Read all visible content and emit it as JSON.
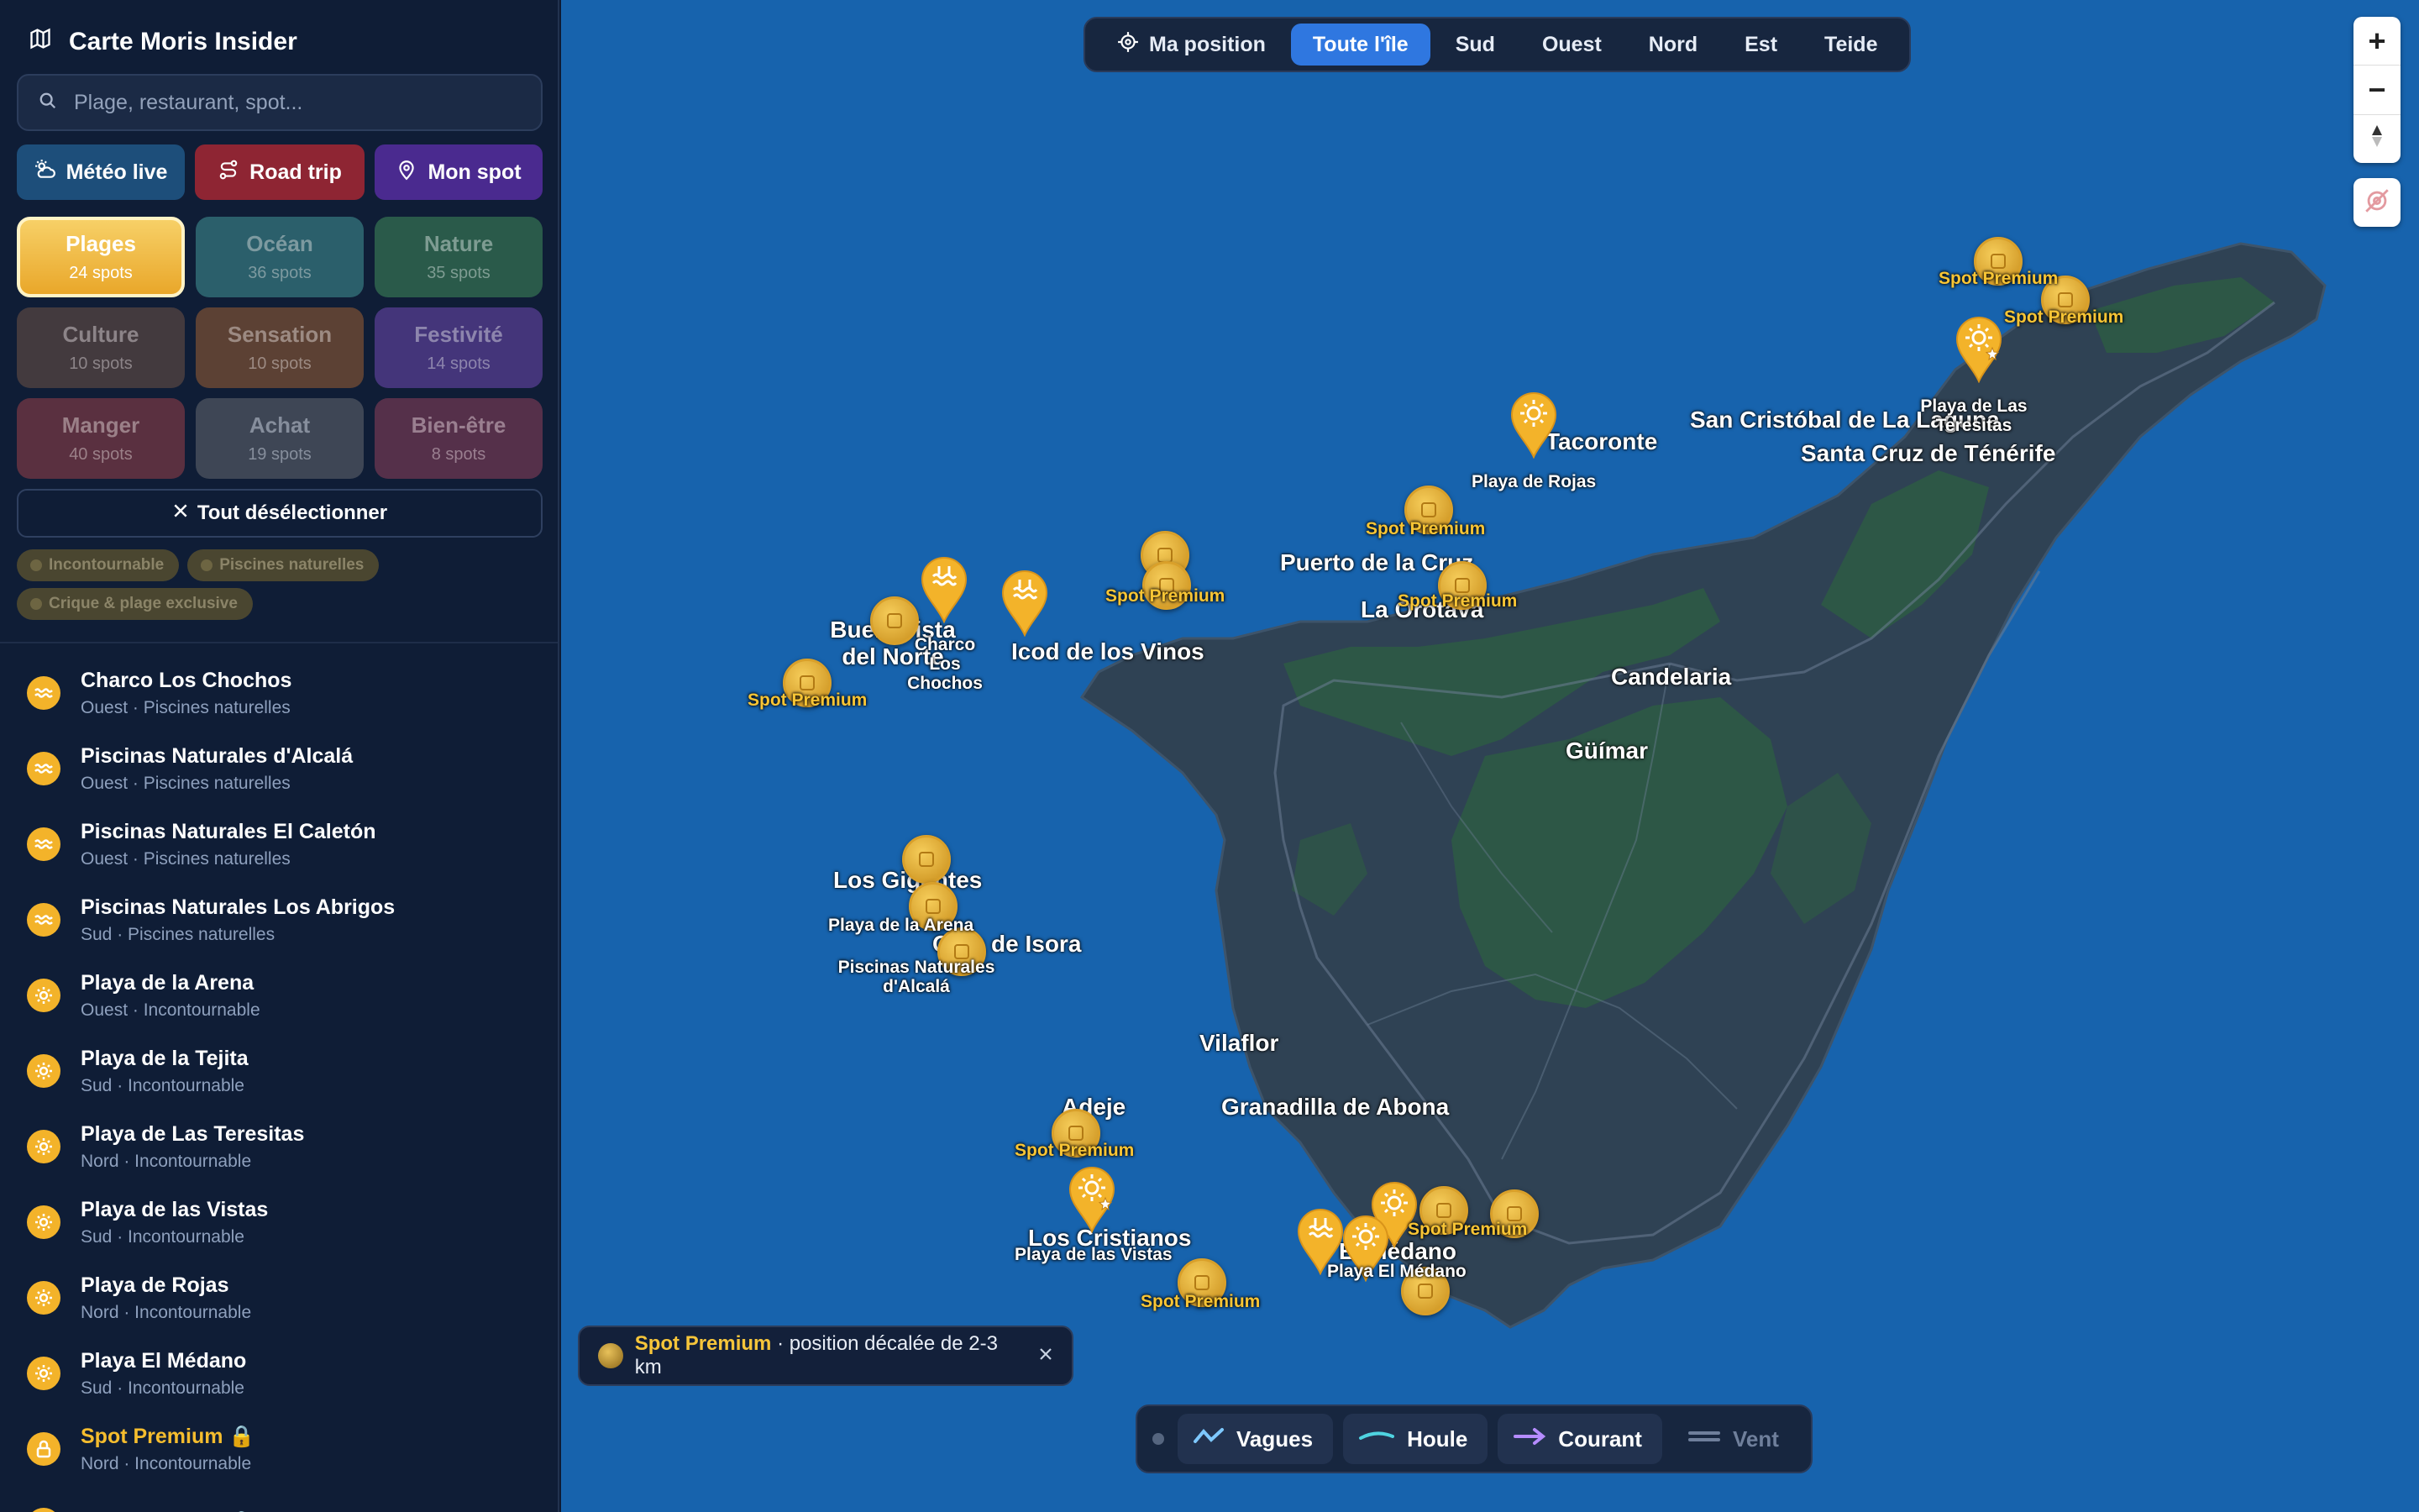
{
  "sidebar": {
    "title": "Carte Moris Insider",
    "search_placeholder": "Plage, restaurant, spot...",
    "actions": [
      {
        "label": "Météo live",
        "color": "#1d4e7a",
        "icon": "weather-icon"
      },
      {
        "label": "Road trip",
        "color": "#8e2533",
        "icon": "route-icon"
      },
      {
        "label": "Mon spot",
        "color": "#4a2a8f",
        "icon": "pin-icon"
      }
    ],
    "categories": [
      {
        "name": "Plages",
        "count": "24 spots",
        "selected": true,
        "color": "#f3c04a"
      },
      {
        "name": "Océan",
        "count": "36 spots",
        "selected": false,
        "color": "#2b5f6b"
      },
      {
        "name": "Nature",
        "count": "35 spots",
        "selected": false,
        "color": "#2a5a4a"
      },
      {
        "name": "Culture",
        "count": "10 spots",
        "selected": false,
        "color": "#433a3e"
      },
      {
        "name": "Sensation",
        "count": "10 spots",
        "selected": false,
        "color": "#5c4134"
      },
      {
        "name": "Festivité",
        "count": "14 spots",
        "selected": false,
        "color": "#44357a"
      },
      {
        "name": "Manger",
        "count": "40 spots",
        "selected": false,
        "color": "#5a3040"
      },
      {
        "name": "Achat",
        "count": "19 spots",
        "selected": false,
        "color": "#3e4655"
      },
      {
        "name": "Bien-être",
        "count": "8 spots",
        "selected": false,
        "color": "#55304a"
      }
    ],
    "deselect_label": "Tout désélectionner",
    "tags": [
      "Incontournable",
      "Piscines naturelles",
      "Crique & plage exclusive"
    ],
    "list": [
      {
        "name": "Charco Los Chochos",
        "meta": "Ouest · Piscines naturelles",
        "icon": "waves-icon",
        "premium": false
      },
      {
        "name": "Piscinas Naturales d'Alcalá",
        "meta": "Ouest · Piscines naturelles",
        "icon": "waves-icon",
        "premium": false
      },
      {
        "name": "Piscinas Naturales El Caletón",
        "meta": "Ouest · Piscines naturelles",
        "icon": "waves-icon",
        "premium": false
      },
      {
        "name": "Piscinas Naturales Los Abrigos",
        "meta": "Sud · Piscines naturelles",
        "icon": "waves-icon",
        "premium": false
      },
      {
        "name": "Playa de la Arena",
        "meta": "Ouest · Incontournable",
        "icon": "sun-icon",
        "premium": false
      },
      {
        "name": "Playa de la Tejita",
        "meta": "Sud · Incontournable",
        "icon": "sun-icon",
        "premium": false
      },
      {
        "name": "Playa de Las Teresitas",
        "meta": "Nord · Incontournable",
        "icon": "sun-icon",
        "premium": false
      },
      {
        "name": "Playa de las Vistas",
        "meta": "Sud · Incontournable",
        "icon": "sun-icon",
        "premium": false
      },
      {
        "name": "Playa de Rojas",
        "meta": "Nord · Incontournable",
        "icon": "sun-icon",
        "premium": false
      },
      {
        "name": "Playa El Médano",
        "meta": "Sud · Incontournable",
        "icon": "sun-icon",
        "premium": false
      },
      {
        "name": "Spot Premium 🔒",
        "meta": "Nord · Incontournable",
        "icon": "lock-icon",
        "premium": true
      },
      {
        "name": "Spot Premium 🔒",
        "meta": "",
        "icon": "lock-icon",
        "premium": true
      }
    ]
  },
  "map": {
    "zones": [
      {
        "label": "Ma position",
        "active": false,
        "icon": "crosshair-icon"
      },
      {
        "label": "Toute l'île",
        "active": true
      },
      {
        "label": "Sud",
        "active": false
      },
      {
        "label": "Ouest",
        "active": false
      },
      {
        "label": "Nord",
        "active": false
      },
      {
        "label": "Est",
        "active": false
      },
      {
        "label": "Teide",
        "active": false
      }
    ],
    "zoom_in": "+",
    "zoom_out": "−",
    "towns": [
      "San Cristóbal de La Laguna",
      "Santa Cruz de Ténérife",
      "Tacoronte",
      "Puerto de la Cruz",
      "La Orotava",
      "Candelaria",
      "Güímar",
      "Buenavista del Norte",
      "Icod de los Vinos",
      "Los Gigantes",
      "Guía de Isora",
      "Vilaflor",
      "Adeje",
      "Granadilla de Abona",
      "Los Cristianos",
      "El Médano"
    ],
    "place_labels": [
      "Playa de Rojas",
      "Playa de Las Teresitas",
      "Charco Los Chochos",
      "Playa de la Arena",
      "Piscinas Naturales d'Alcalá",
      "Playa de las Vistas",
      "Playa El Médano"
    ],
    "premium_label": "Spot Premium",
    "toast": {
      "bold": "Spot Premium",
      "text": " · position décalée de 2-3 km"
    },
    "layers": [
      {
        "label": "Vagues",
        "active": true,
        "color": "#7ec8ff"
      },
      {
        "label": "Houle",
        "active": true,
        "color": "#4fd3e0"
      },
      {
        "label": "Courant",
        "active": true,
        "color": "#b58cff"
      },
      {
        "label": "Vent",
        "active": false,
        "color": "#6f7f9b"
      }
    ]
  },
  "colors": {
    "accent": "#2f77e0",
    "premium": "#f5bd2e",
    "ocean": "#1763ad",
    "pin": "#f3b32a"
  }
}
